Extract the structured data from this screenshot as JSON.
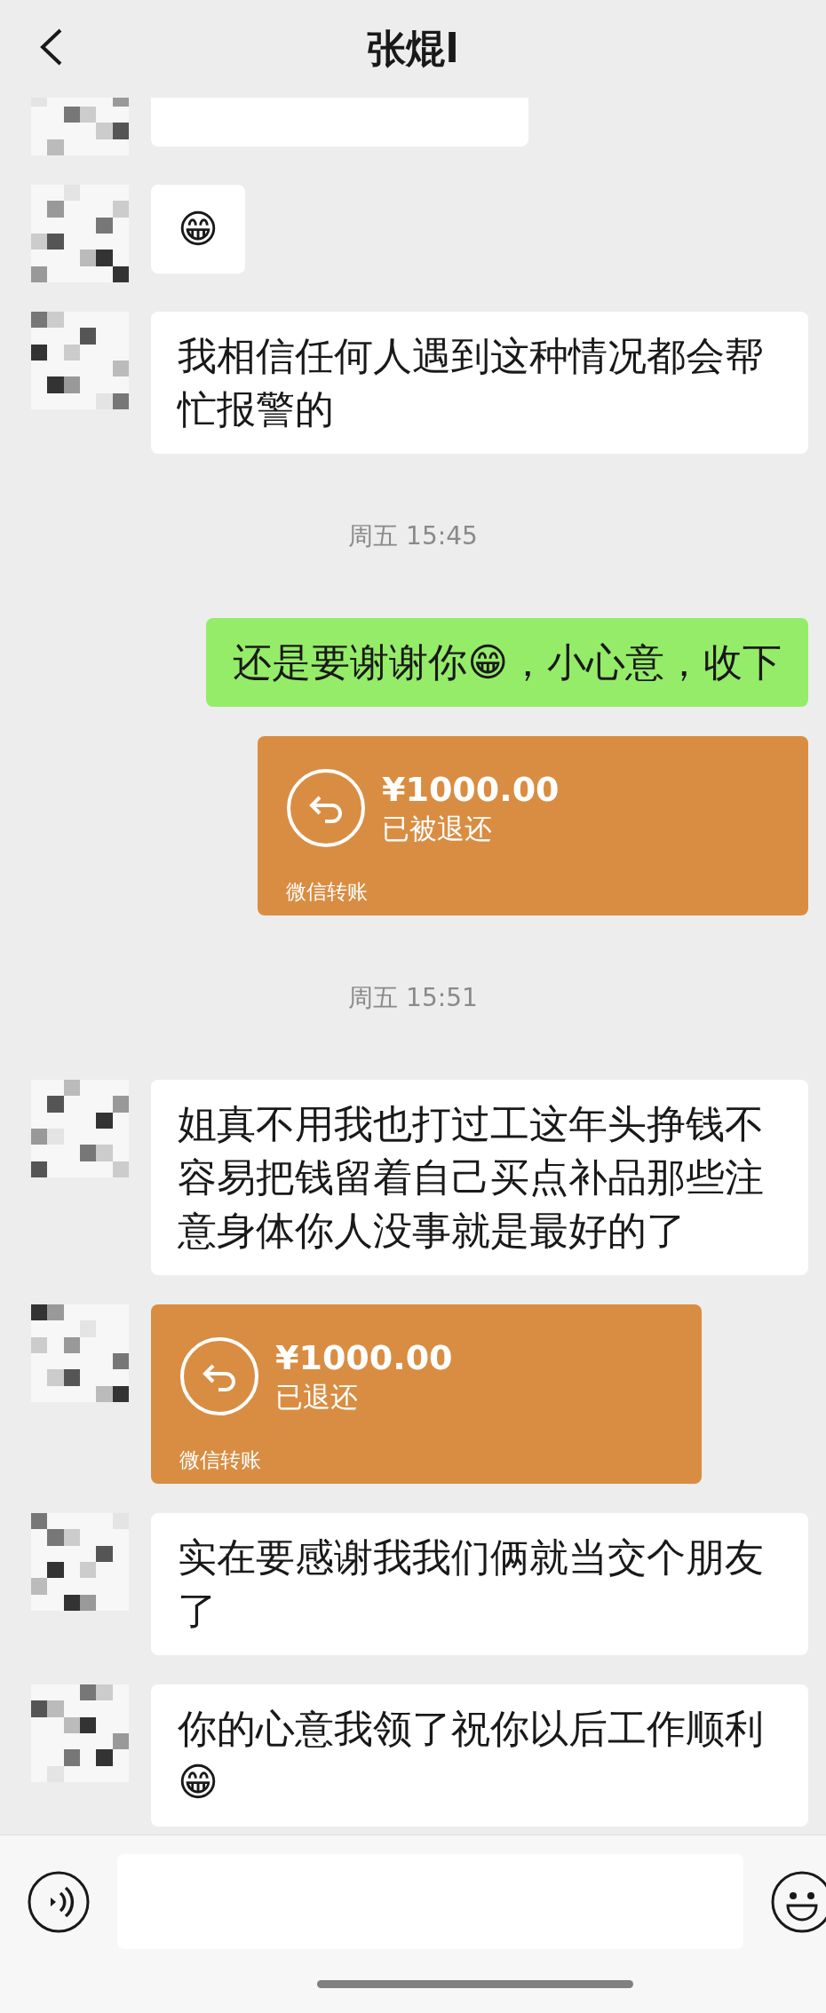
{
  "header": {
    "title": "张焜l"
  },
  "messages": [
    {
      "kind": "cut",
      "outgoing": false
    },
    {
      "kind": "text",
      "outgoing": false,
      "text": "😁"
    },
    {
      "kind": "text",
      "outgoing": false,
      "text": "我相信任何人遇到这种情况都会帮忙报警的"
    },
    {
      "kind": "time",
      "text": "周五 15:45"
    },
    {
      "kind": "text",
      "outgoing": true,
      "text": "还是要谢谢你😁，小心意，收下"
    },
    {
      "kind": "transfer",
      "outgoing": true,
      "amount": "¥1000.00",
      "status": "已被退还",
      "footer": "微信转账"
    },
    {
      "kind": "time",
      "text": "周五 15:51"
    },
    {
      "kind": "text",
      "outgoing": false,
      "text": "姐真不用我也打过工这年头挣钱不容易把钱留着自己买点补品那些注意身体你人没事就是最好的了"
    },
    {
      "kind": "transfer",
      "outgoing": false,
      "amount": "¥1000.00",
      "status": "已退还",
      "footer": "微信转账"
    },
    {
      "kind": "text",
      "outgoing": false,
      "text": "实在要感谢我我们俩就当交个朋友了"
    },
    {
      "kind": "text",
      "outgoing": false,
      "text": "你的心意我领了祝你以后工作顺利😁"
    }
  ]
}
